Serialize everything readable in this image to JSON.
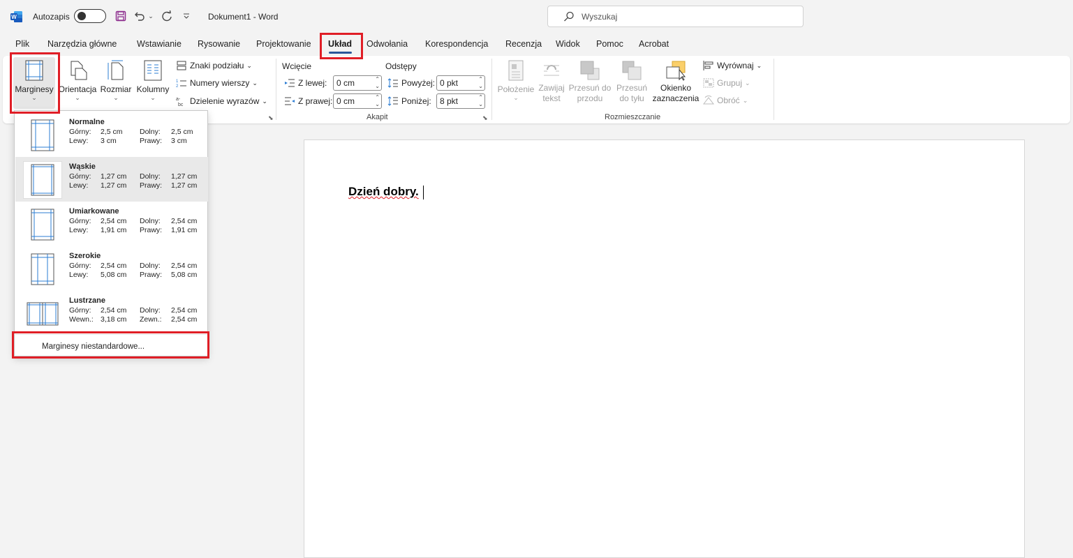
{
  "titlebar": {
    "autosave_label": "Autozapis",
    "doc_title": "Dokument1  -  Word",
    "search_placeholder": "Wyszukaj"
  },
  "tabs": [
    "Plik",
    "Narzędzia główne",
    "Wstawianie",
    "Rysowanie",
    "Projektowanie",
    "Układ",
    "Odwołania",
    "Korespondencja",
    "Recenzja",
    "Widok",
    "Pomoc",
    "Acrobat"
  ],
  "active_tab": "Układ",
  "ribbon": {
    "page_setup": {
      "margins": "Marginesy",
      "orientation": "Orientacja",
      "size": "Rozmiar",
      "columns": "Kolumny",
      "breaks": "Znaki podziału",
      "line_numbers": "Numery wierszy",
      "hyphenation": "Dzielenie wyrazów"
    },
    "paragraph": {
      "indent_title": "Wcięcie",
      "spacing_title": "Odstępy",
      "left_label": "Z lewej:",
      "right_label": "Z prawej:",
      "before_label": "Powyżej:",
      "after_label": "Poniżej:",
      "left_value": "0 cm",
      "right_value": "0 cm",
      "before_value": "0 pkt",
      "after_value": "8 pkt",
      "group_label": "Akapit"
    },
    "arrange": {
      "position": "Położenie",
      "wrap_1": "Zawijaj",
      "wrap_2": "tekst",
      "forward_1": "Przesuń do",
      "forward_2": "przodu",
      "backward_1": "Przesuń",
      "backward_2": "do tyłu",
      "pane_1": "Okienko",
      "pane_2": "zaznaczenia",
      "align": "Wyrównaj",
      "group": "Grupuj",
      "rotate": "Obróć",
      "group_label": "Rozmieszczanie"
    }
  },
  "margins_menu": {
    "items": [
      {
        "name": "Normalne",
        "r1": [
          "Górny:",
          "2,5  cm",
          "Dolny:",
          "2,5  cm"
        ],
        "r2": [
          "Lewy:",
          "3  cm",
          "Prawy:",
          "3  cm"
        ]
      },
      {
        "name": "Wąskie",
        "r1": [
          "Górny:",
          "1,27  cm",
          "Dolny:",
          "1,27  cm"
        ],
        "r2": [
          "Lewy:",
          "1,27  cm",
          "Prawy:",
          "1,27  cm"
        ]
      },
      {
        "name": "Umiarkowane",
        "r1": [
          "Górny:",
          "2,54  cm",
          "Dolny:",
          "2,54  cm"
        ],
        "r2": [
          "Lewy:",
          "1,91  cm",
          "Prawy:",
          "1,91  cm"
        ]
      },
      {
        "name": "Szerokie",
        "r1": [
          "Górny:",
          "2,54  cm",
          "Dolny:",
          "2,54  cm"
        ],
        "r2": [
          "Lewy:",
          "5,08  cm",
          "Prawy:",
          "5,08  cm"
        ]
      },
      {
        "name": "Lustrzane",
        "r1": [
          "Górny:",
          "2,54  cm",
          "Dolny:",
          "2,54  cm"
        ],
        "r2": [
          "Wewn.:",
          "3,18  cm",
          "Zewn.:",
          "2,54  cm"
        ]
      }
    ],
    "custom": "Marginesy niestandardowe..."
  },
  "document": {
    "text": "Dzień dobry."
  },
  "colors": {
    "accent": "#2b579a",
    "highlight_box": "#e01e26"
  }
}
